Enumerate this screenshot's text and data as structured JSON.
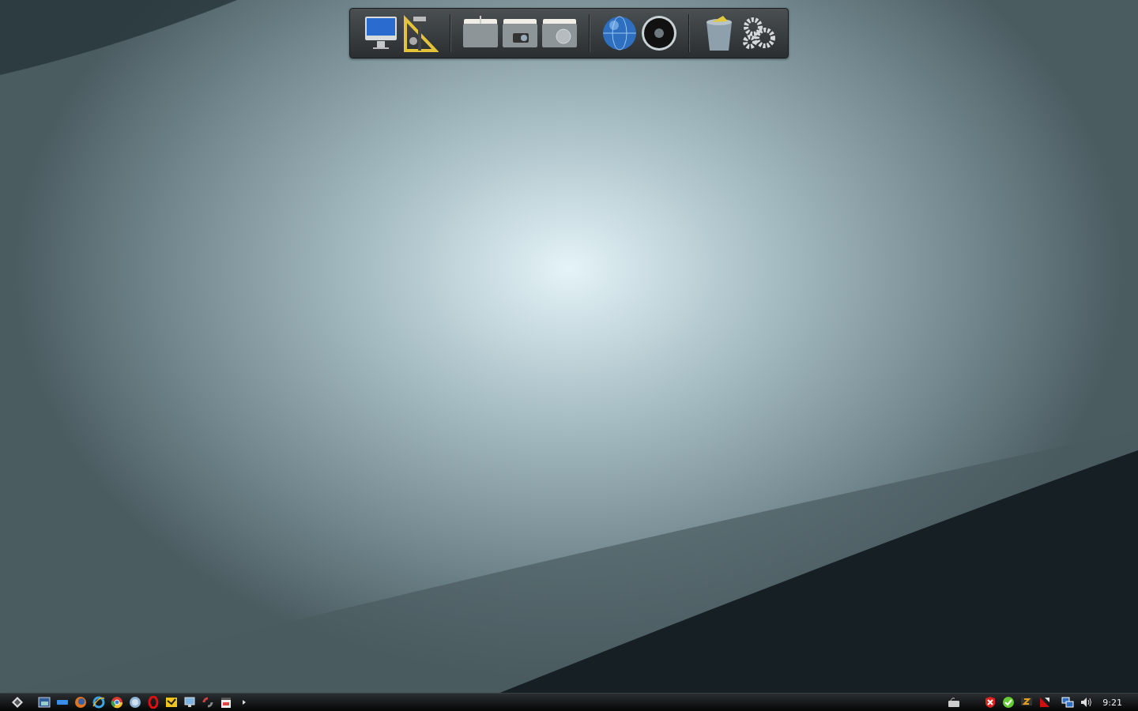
{
  "taskbar": {
    "clock": "9:21"
  }
}
